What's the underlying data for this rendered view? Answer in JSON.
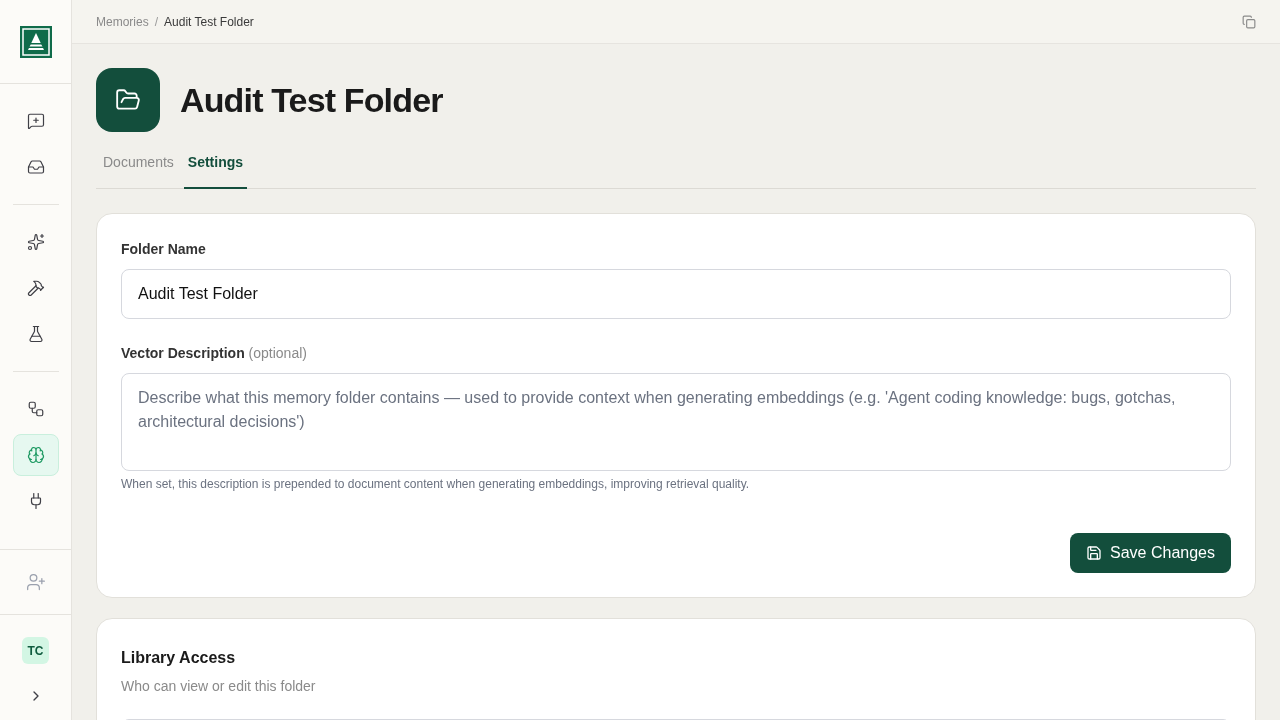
{
  "sidebar": {
    "groups": [
      [
        {
          "selected": false
        },
        {
          "selected": false
        }
      ],
      [
        {
          "selected": false
        },
        {
          "selected": false
        },
        {
          "selected": false
        }
      ],
      [
        {
          "selected": false
        },
        {
          "selected": true
        },
        {
          "selected": false
        }
      ]
    ],
    "avatar": "TC"
  },
  "breadcrumb": {
    "items": [
      "Memories",
      "Audit Test Folder"
    ],
    "separator": "/"
  },
  "title": "Audit Test Folder",
  "tabs": [
    {
      "label": "Documents",
      "selected": false
    },
    {
      "label": "Settings",
      "selected": true
    }
  ],
  "settings": {
    "name_label": "Folder Name",
    "name_value": "Audit Test Folder",
    "desc_label": "Vector Description",
    "desc_optional": "(optional)",
    "desc_placeholder": "Describe what this memory folder contains — used to provide context when generating embeddings (e.g. 'Agent coding knowledge: bugs, gotchas, architectural decisions')",
    "desc_hint": "When set, this description is prepended to document content when generating embeddings, improving retrieval quality.",
    "save": "Save Changes"
  },
  "access": {
    "title": "Library Access",
    "subtitle": "Who can view or edit this folder"
  }
}
